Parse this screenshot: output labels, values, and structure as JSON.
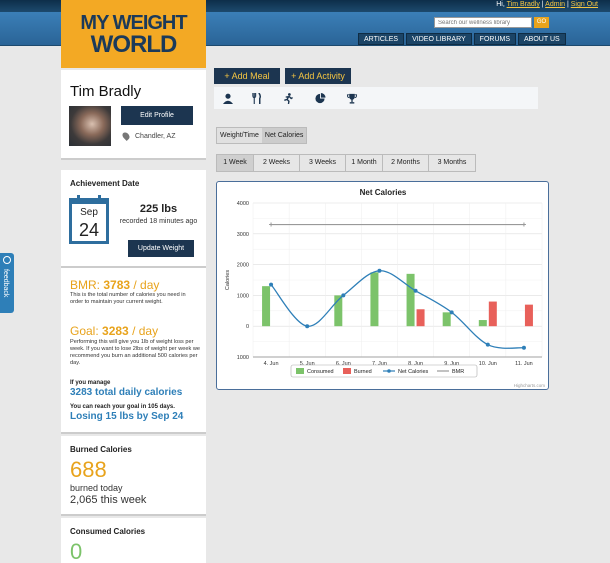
{
  "header": {
    "greeting_prefix": "Hi,",
    "user_link": "Tim Bradly",
    "sep1": "|",
    "admin_link": "Admin",
    "sep2": "|",
    "signout_link": "Sign Out",
    "search_placeholder": "Search our wellness library",
    "go_label": "GO",
    "nav": [
      "ARTICLES",
      "VIDEO LIBRARY",
      "FORUMS",
      "ABOUT US"
    ]
  },
  "logo": {
    "line1": "MY WEIGHT",
    "line2": "WORLD"
  },
  "feedback_label": "feedback",
  "profile": {
    "name": "Tim Bradly",
    "edit_label": "Edit Profile",
    "location": "Chandler, AZ"
  },
  "achievement": {
    "title": "Achievement Date",
    "month": "Sep",
    "day": "24",
    "weight": "225 lbs",
    "recorded": "recorded 18 minutes ago",
    "update_label": "Update Weight"
  },
  "goals": {
    "bmr_label": "BMR:",
    "bmr_value": "3783",
    "bmr_unit": "/ day",
    "bmr_text": "This is the total number of calories you need in order to maintain your current weight.",
    "goal_label": "Goal:",
    "goal_value": "3283",
    "goal_unit": "/ day",
    "goal_text": "Performing this will give you 1lb of weight loss per week. If you want to lose 2lbs of weight per week we recommend you burn an additional 500 calories per day.",
    "if_manage": "If you manage",
    "total_daily": "3283 total daily calories",
    "reach": "You can reach your goal in 105 days.",
    "losing": "Losing 15 lbs by Sep 24"
  },
  "burned": {
    "title": "Burned Calories",
    "value": "688",
    "today": "burned today",
    "week": "2,065 this week"
  },
  "consumed": {
    "title": "Consumed Calories",
    "value": "0"
  },
  "actions": {
    "add_meal": "+ Add Meal",
    "add_activity": "+ Add Activity"
  },
  "icons": [
    "person-icon",
    "fork-knife-icon",
    "runner-icon",
    "pie-chart-icon",
    "trophy-icon"
  ],
  "toggle": [
    "Weight/Time",
    "Net Calories"
  ],
  "ranges": [
    "1 Week",
    "2 Weeks",
    "3 Weeks",
    "1 Month",
    "2 Months",
    "3 Months"
  ],
  "colors": {
    "consumed": "#7cc36a",
    "burned": "#e8605a",
    "net": "#2e7fb8",
    "bmr": "#999999",
    "accent": "#e8a31c",
    "navy": "#1c3550"
  },
  "chart_data": {
    "type": "bar",
    "title": "Net Calories",
    "ylabel": "Calories",
    "ylim": [
      -1000,
      4000
    ],
    "yticks": [
      "4000",
      "3000",
      "2000",
      "1000",
      "0",
      "1000"
    ],
    "categories": [
      "4. Jun",
      "5. Jun",
      "6. Jun",
      "7. Jun",
      "8. Jun",
      "9. Jun",
      "10. Jun",
      "11. Jun"
    ],
    "series": [
      {
        "name": "Consumed",
        "type": "bar",
        "values": [
          1300,
          0,
          1000,
          1750,
          1700,
          450,
          200,
          0
        ]
      },
      {
        "name": "Burned",
        "type": "bar",
        "values": [
          0,
          0,
          0,
          0,
          550,
          0,
          800,
          700
        ]
      },
      {
        "name": "Net Calories",
        "type": "line",
        "values": [
          1350,
          0,
          1000,
          1800,
          1150,
          450,
          -600,
          -700
        ]
      },
      {
        "name": "BMR",
        "type": "line",
        "values": [
          3300,
          3300,
          3300,
          3300,
          3300,
          3300,
          3300,
          3300
        ]
      }
    ],
    "legend": "bottom",
    "credit": "Highcharts.com"
  }
}
